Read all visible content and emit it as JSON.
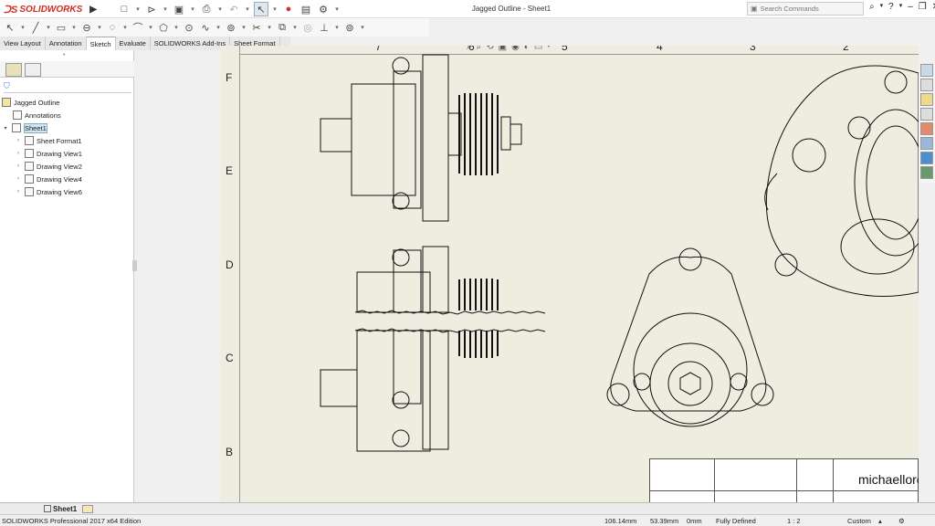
{
  "app": {
    "name": "SOLIDWORKS",
    "doc_title": "Jagged Outline - Sheet1"
  },
  "search": {
    "placeholder": "Search Commands"
  },
  "tabs": [
    {
      "label": "View Layout"
    },
    {
      "label": "Annotation"
    },
    {
      "label": "Sketch"
    },
    {
      "label": "Evaluate"
    },
    {
      "label": "SOLIDWORKS Add-Ins"
    },
    {
      "label": "Sheet Format"
    }
  ],
  "active_tab": "Sketch",
  "tree": {
    "root": "Jagged Outline",
    "annotations": "Annotations",
    "sheet": "Sheet1",
    "children": [
      "Sheet Format1",
      "Drawing View1",
      "Drawing View2",
      "Drawing View4",
      "Drawing View6"
    ]
  },
  "drawing": {
    "zone_letters": [
      "F",
      "E",
      "D",
      "C",
      "B"
    ],
    "zone_numbers": [
      "7",
      "6",
      "5",
      "4",
      "3",
      "2"
    ],
    "brand_text": "michaellore"
  },
  "sheet_tabs": {
    "active": "Sheet1"
  },
  "status": {
    "edition": "SOLIDWORKS Professional 2017 x64 Edition",
    "x": "106.14mm",
    "y": "53.39mm",
    "z": "0mm",
    "state": "Fully Defined",
    "scale": "1 : 2",
    "units": "Custom"
  }
}
